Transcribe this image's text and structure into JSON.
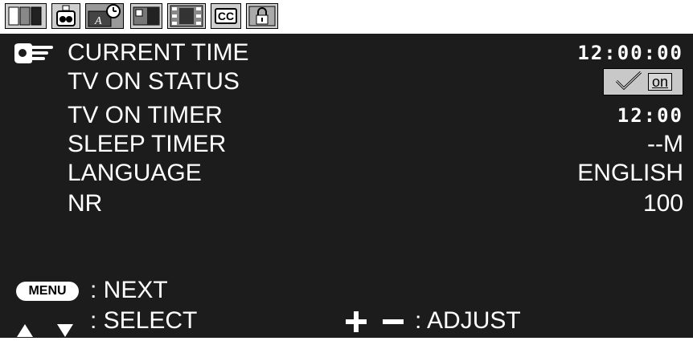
{
  "tabs": [
    {
      "icon": "tv-picture-icon",
      "active": false
    },
    {
      "icon": "audio-speaker-icon",
      "active": false
    },
    {
      "icon": "timer-clock-icon",
      "active": true
    },
    {
      "icon": "display-panel-icon",
      "active": false
    },
    {
      "icon": "film-strip-icon",
      "active": false
    },
    {
      "icon": "closed-caption-icon",
      "active": false,
      "label": "CC"
    },
    {
      "icon": "parental-lock-icon",
      "active": false
    }
  ],
  "rows": [
    {
      "label": "CURRENT TIME",
      "value": "12:00:00",
      "selected": true
    },
    {
      "label": "TV ON STATUS",
      "value": "on",
      "checked": true
    },
    {
      "label": "TV ON TIMER",
      "value": "12:00"
    },
    {
      "label": "SLEEP TIMER",
      "value": "--M"
    },
    {
      "label": "LANGUAGE",
      "value": "ENGLISH"
    },
    {
      "label": "NR",
      "value": "100"
    }
  ],
  "footer": {
    "menu_key": "MENU",
    "next_label": ": NEXT",
    "select_label": ": SELECT",
    "adjust_label": ": ADJUST"
  },
  "colors": {
    "panel": "#1c1c1c",
    "text": "#ffffff",
    "tab_bg": "#cfcfcf",
    "tab_active": "#9a9a9a"
  }
}
